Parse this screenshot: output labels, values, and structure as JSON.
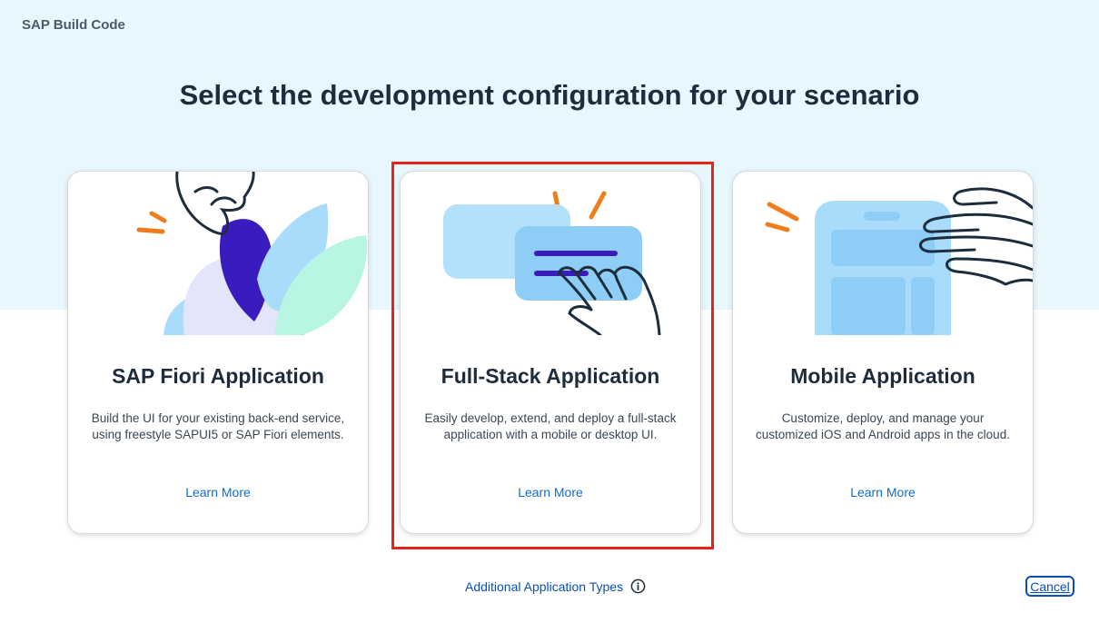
{
  "header": {
    "app_title": "SAP Build Code"
  },
  "main": {
    "heading": "Select the development configuration for your scenario",
    "cards": [
      {
        "title": "SAP Fiori Application",
        "description": "Build the UI for your existing back-end service, using freestyle SAPUI5 or SAP Fiori elements.",
        "link": "Learn More",
        "illustration": "hand-with-leaves-illustration"
      },
      {
        "title": "Full-Stack Application",
        "description": "Easily develop, extend, and deploy a full-stack application with a mobile or desktop UI.",
        "link": "Learn More",
        "illustration": "hand-tapping-screens-illustration",
        "highlighted": true
      },
      {
        "title": "Mobile Application",
        "description": "Customize, deploy, and manage your customized iOS and Android apps in the cloud.",
        "link": "Learn More",
        "illustration": "hand-swiping-phone-illustration"
      }
    ]
  },
  "footer": {
    "additional_types_label": "Additional Application Types",
    "info_icon": "info-icon",
    "cancel_label": "Cancel"
  },
  "colors": {
    "hero_background": "#e8f6fd",
    "link": "#0a4fb3",
    "highlight_border": "#e3241b",
    "accent_orange": "#ef7d1b",
    "accent_indigo": "#3a1bbd",
    "light_blue": "#a8dcfa",
    "mint": "#b8f5e3"
  }
}
